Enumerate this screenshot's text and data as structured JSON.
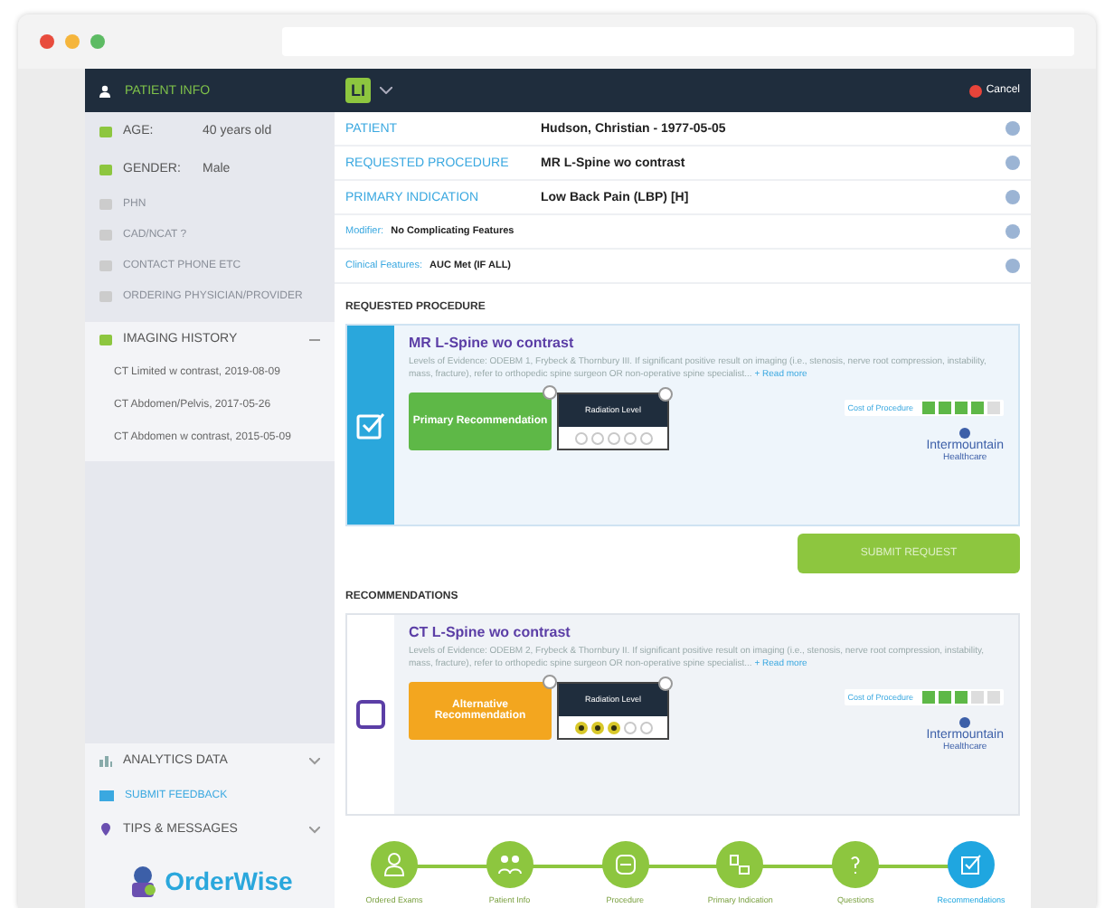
{
  "sidebar": {
    "header": "PATIENT INFO",
    "fields": [
      {
        "label": "AGE:",
        "value": "40 years old",
        "disabled": false
      },
      {
        "label": "GENDER:",
        "value": "Male",
        "disabled": false
      },
      {
        "label": "PHN",
        "disabled": true
      },
      {
        "label": "CAD/NCAT ?",
        "disabled": true
      },
      {
        "label": "CONTACT PHONE ETC",
        "disabled": true
      },
      {
        "label": "ORDERING PHYSICIAN/PROVIDER",
        "disabled": true
      }
    ],
    "imaging_history": {
      "label": "IMAGING HISTORY",
      "expanded": true,
      "children": [
        {
          "label": "CT Limited w contrast, 2019-08-09"
        },
        {
          "label": "CT Abdomen/Pelvis, 2017-05-26"
        },
        {
          "label": "CT Abdomen w contrast, 2015-05-09"
        }
      ]
    },
    "bottom": [
      {
        "kind": "section",
        "label": "ANALYTICS DATA",
        "expanded": false
      },
      {
        "kind": "link",
        "label": "SUBMIT FEEDBACK"
      },
      {
        "kind": "section",
        "label": "TIPS & MESSAGES",
        "expanded": false
      }
    ],
    "logo": "OrderWise"
  },
  "toolbar": {
    "badge": "LI",
    "cancel": "Cancel"
  },
  "summary": [
    {
      "label": "PATIENT",
      "value": "Hudson, Christian - 1977-05-05",
      "kind": "large"
    },
    {
      "label": "REQUESTED PROCEDURE",
      "value": "MR L-Spine wo contrast",
      "kind": "large"
    },
    {
      "label": "PRIMARY INDICATION",
      "value": "Low Back Pain (LBP) [H]",
      "kind": "large"
    },
    {
      "label": "Modifier:",
      "value": "No Complicating Features",
      "kind": "small"
    },
    {
      "label": "Clinical Features:",
      "value": "AUC Met (IF ALL)",
      "kind": "small"
    }
  ],
  "sections": [
    {
      "title": "REQUESTED PROCEDURE",
      "cards": [
        {
          "title": "MR L-Spine wo contrast",
          "checked": true,
          "kind": "primary",
          "description": "Levels of Evidence: ODEBM 1, Frybeck & Thornbury III. If significant positive result on imaging (i.e., stenosis, nerve root compression, instability, mass, fracture), refer to orthopedic spine surgeon OR non-operative spine specialist...",
          "more": "+ Read more",
          "recommendation": "Primary Recommendation",
          "radiation": {
            "label": "Radiation Level",
            "stars": 0
          },
          "cost": {
            "label": "Cost of Procedure",
            "stars": 4
          },
          "provider": [
            "Intermountain",
            "Healthcare"
          ]
        }
      ],
      "action": "SUBMIT REQUEST"
    },
    {
      "title": "RECOMMENDATIONS",
      "cards": [
        {
          "title": "CT L-Spine wo contrast",
          "checked": false,
          "kind": "alternative",
          "description": "Levels of Evidence: ODEBM 2, Frybeck & Thornbury II. If significant positive result on imaging (i.e., stenosis, nerve root compression, instability, mass, fracture), refer to orthopedic spine surgeon OR non-operative spine specialist...",
          "more": "+ Read more",
          "recommendation": "Alternative Recommendation",
          "radiation": {
            "label": "Radiation Level",
            "stars": 3
          },
          "cost": {
            "label": "Cost of Procedure",
            "stars": 3
          },
          "provider": [
            "Intermountain",
            "Healthcare"
          ]
        }
      ]
    }
  ],
  "steps": [
    {
      "label": "Ordered Exams",
      "selected": false
    },
    {
      "label": "Patient Info",
      "selected": false
    },
    {
      "label": "Procedure",
      "selected": false
    },
    {
      "label": "Primary Indication",
      "selected": false
    },
    {
      "label": "Questions",
      "selected": false
    },
    {
      "label": "Recommendations",
      "selected": true
    }
  ]
}
